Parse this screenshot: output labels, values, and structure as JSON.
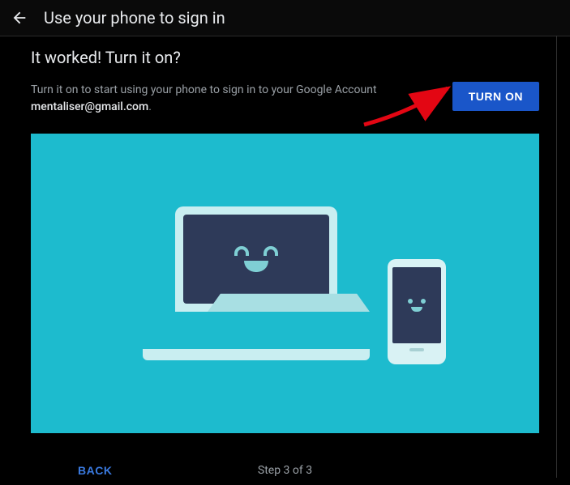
{
  "header": {
    "title": "Use your phone to sign in"
  },
  "page": {
    "heading": "It worked! Turn it on?",
    "description": "Turn it on to start using your phone to sign in to your Google Account",
    "email": "mentaliser@gmail.com"
  },
  "actions": {
    "turn_on_label": "TURN ON",
    "back_label": "BACK"
  },
  "footer": {
    "step_text": "Step 3 of 3"
  }
}
